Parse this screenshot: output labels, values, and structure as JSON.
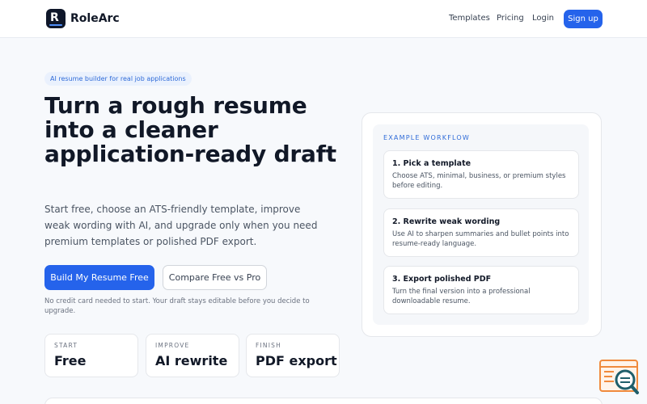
{
  "header": {
    "brand": "RoleArc",
    "logo_letter": "R",
    "nav": {
      "templates": "Templates",
      "pricing": "Pricing",
      "login": "Login",
      "signup": "Sign up"
    }
  },
  "hero": {
    "tag": "AI resume builder for real job applications",
    "headline": "Turn a rough resume into a cleaner application-ready draft",
    "subtext": "Start free, choose an ATS-friendly template, improve weak wording with AI, and upgrade only when you need premium templates or polished PDF export.",
    "primary_cta": "Build My Resume Free",
    "secondary_cta": "Compare Free vs Pro",
    "note": "No credit card needed to start. Your draft stays editable before you decide to upgrade."
  },
  "stats": [
    {
      "label": "START",
      "value": "Free"
    },
    {
      "label": "IMPROVE",
      "value": "AI rewrite"
    },
    {
      "label": "FINISH",
      "value": "PDF export"
    }
  ],
  "workflow": {
    "heading": "EXAMPLE WORKFLOW",
    "steps": [
      {
        "title": "1. Pick a template",
        "desc": "Choose ATS, minimal, business, or premium styles before editing."
      },
      {
        "title": "2. Rewrite weak wording",
        "desc": "Use AI to sharpen summaries and bullet points into resume-ready language."
      },
      {
        "title": "3. Export polished PDF",
        "desc": "Turn the final version into a professional downloadable resume."
      }
    ]
  },
  "colors": {
    "accent": "#2563eb",
    "text_dark": "#111827",
    "background": "#f7f9fc",
    "widget_orange": "#f08a3c",
    "widget_teal": "#1f5f6b"
  },
  "icons": {
    "logo": "rolearc-logo-icon",
    "widget": "search-document-widget-icon"
  }
}
